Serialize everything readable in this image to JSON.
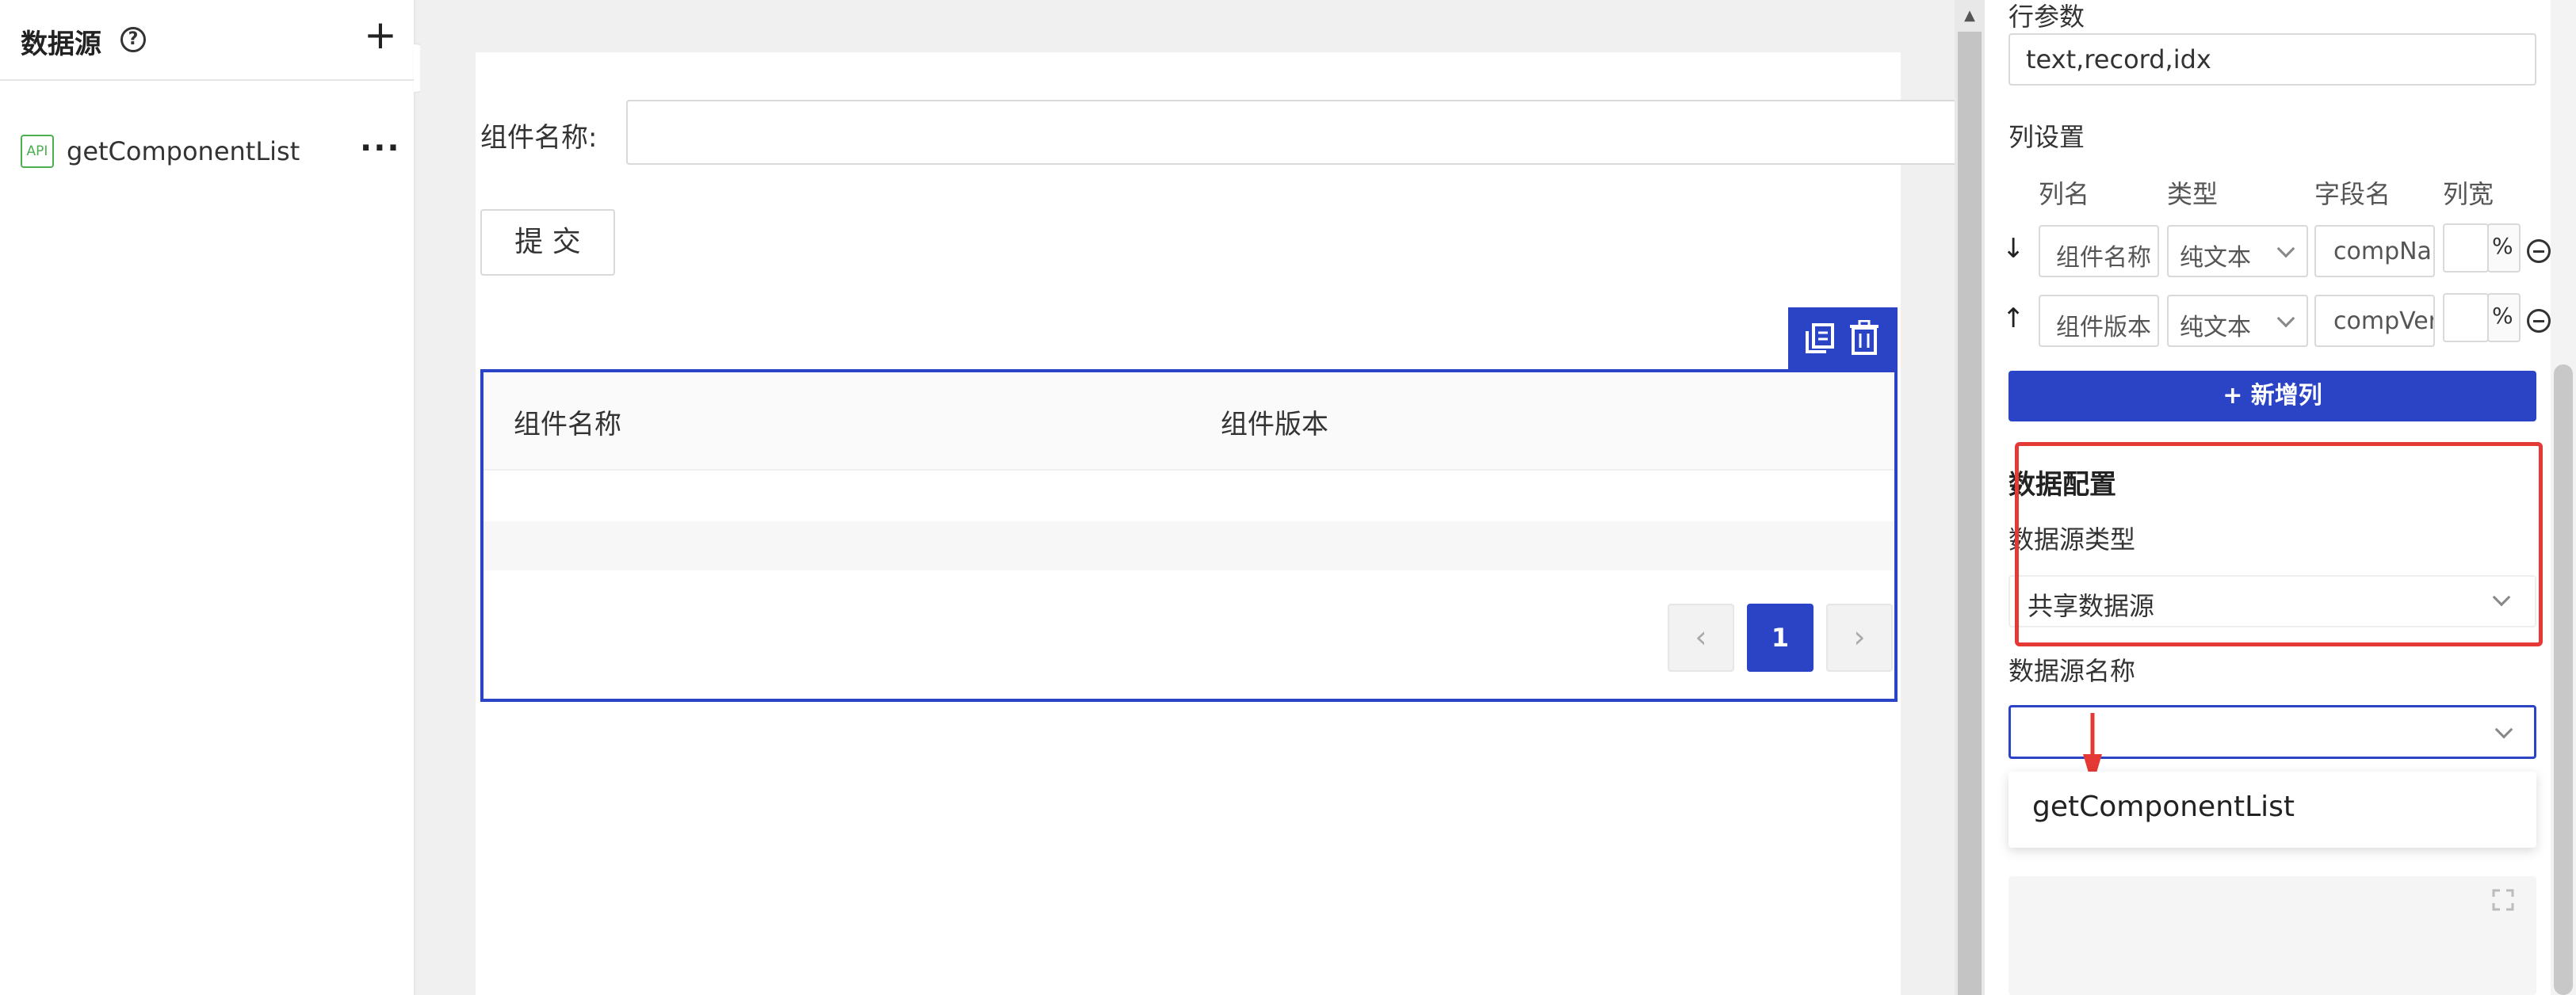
{
  "left_panel": {
    "title": "数据源",
    "help_glyph": "?",
    "add_glyph": "+",
    "items": [
      {
        "type_badge": "API",
        "name": "getComponentList",
        "more_glyph": "···"
      }
    ]
  },
  "canvas": {
    "form": {
      "label": "组件名称:",
      "input_value": ""
    },
    "submit_label": "提 交",
    "table": {
      "headers": [
        "组件名称",
        "组件版本"
      ],
      "pagination": {
        "current": "1",
        "prev_glyph": "‹",
        "next_glyph": "›"
      }
    }
  },
  "right_panel": {
    "row_params_label": "行参数",
    "row_params_value": "text,record,idx",
    "column_settings_label": "列设置",
    "column_headers": [
      "列名",
      "类型",
      "字段名",
      "列宽"
    ],
    "columns": [
      {
        "arrow": "↓",
        "name": "组件名称",
        "type": "纯文本",
        "field": "compName",
        "width": "",
        "unit": "%"
      },
      {
        "arrow": "↑",
        "name": "组件版本",
        "type": "纯文本",
        "field": "compVersion",
        "width": "",
        "unit": "%"
      }
    ],
    "add_column_label": "+ 新增列",
    "data_config": {
      "title": "数据配置",
      "source_type_label": "数据源类型",
      "source_type_value": "共享数据源",
      "source_name_label": "数据源名称",
      "source_name_value": "",
      "dropdown_options": [
        "getComponentList"
      ]
    }
  },
  "colors": {
    "primary": "#2b44c6",
    "highlight": "#e53935"
  }
}
